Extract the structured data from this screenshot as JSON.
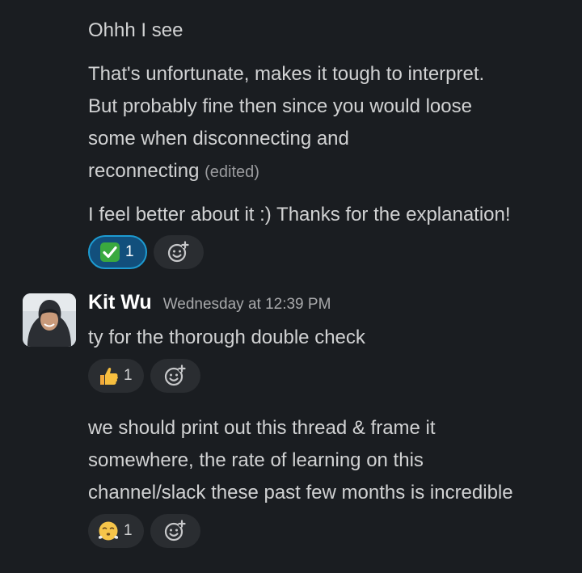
{
  "messages": {
    "m1": {
      "text": "Ohhh I see"
    },
    "m2": {
      "text": "That's unfortunate, makes it tough to interpret.\nBut probably fine then since you would loose\nsome when disconnecting and\nreconnecting",
      "edited_label": "(edited)"
    },
    "m3": {
      "text": "I feel better about it :) Thanks for the explanation!",
      "reaction": {
        "emoji": "check-mark",
        "count": "1"
      }
    },
    "m4": {
      "author": "Kit Wu",
      "timestamp": "Wednesday at 12:39 PM",
      "text": "ty for the thorough double check",
      "reaction": {
        "emoji": "thumbs-up",
        "count": "1"
      }
    },
    "m5": {
      "text": "we should print out this thread & frame it\nsomewhere, the rate of learning on this\nchannel/slack these past few months is incredible",
      "reaction": {
        "emoji": "face-with-steam",
        "count": "1"
      }
    }
  },
  "colors": {
    "background": "#1a1d21",
    "text": "#d1d2d3",
    "active_reaction_bg": "#124f7c",
    "active_reaction_border": "#1d9bd1"
  }
}
